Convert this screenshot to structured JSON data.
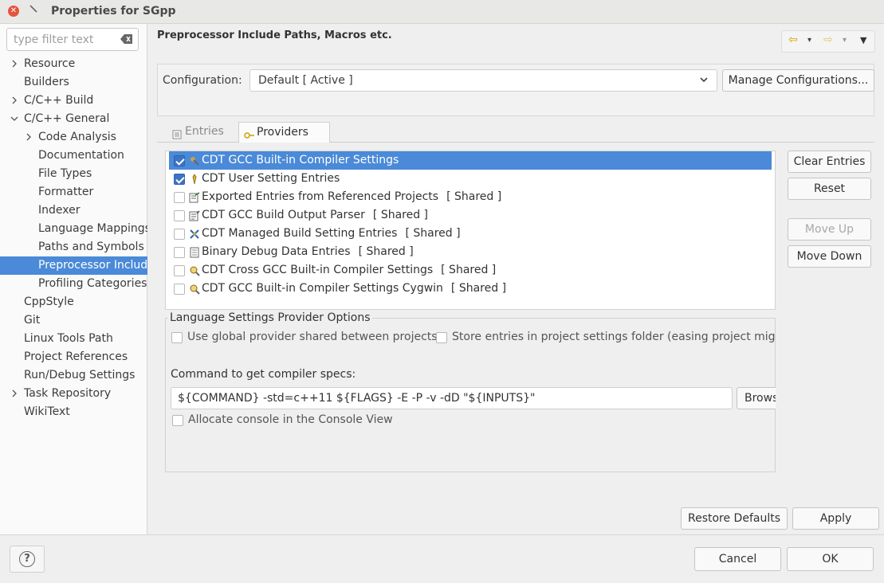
{
  "window": {
    "title": "Properties for SGpp"
  },
  "sidebar": {
    "filter_placeholder": "type filter text",
    "items": [
      {
        "label": "Resource",
        "indent": 0,
        "twisty": "closed"
      },
      {
        "label": "Builders",
        "indent": 0,
        "twisty": "none"
      },
      {
        "label": "C/C++ Build",
        "indent": 0,
        "twisty": "closed"
      },
      {
        "label": "C/C++ General",
        "indent": 0,
        "twisty": "open"
      },
      {
        "label": "Code Analysis",
        "indent": 1,
        "twisty": "closed"
      },
      {
        "label": "Documentation",
        "indent": 1,
        "twisty": "none"
      },
      {
        "label": "File Types",
        "indent": 1,
        "twisty": "none"
      },
      {
        "label": "Formatter",
        "indent": 1,
        "twisty": "none"
      },
      {
        "label": "Indexer",
        "indent": 1,
        "twisty": "none"
      },
      {
        "label": "Language Mappings",
        "indent": 1,
        "twisty": "none"
      },
      {
        "label": "Paths and Symbols",
        "indent": 1,
        "twisty": "none"
      },
      {
        "label": "Preprocessor Include Paths, Macros etc.",
        "indent": 1,
        "twisty": "none",
        "selected": true
      },
      {
        "label": "Profiling Categories",
        "indent": 1,
        "twisty": "none"
      },
      {
        "label": "CppStyle",
        "indent": 0,
        "twisty": "none"
      },
      {
        "label": "Git",
        "indent": 0,
        "twisty": "none"
      },
      {
        "label": "Linux Tools Path",
        "indent": 0,
        "twisty": "none"
      },
      {
        "label": "Project References",
        "indent": 0,
        "twisty": "none"
      },
      {
        "label": "Run/Debug Settings",
        "indent": 0,
        "twisty": "none"
      },
      {
        "label": "Task Repository",
        "indent": 0,
        "twisty": "closed"
      },
      {
        "label": "WikiText",
        "indent": 0,
        "twisty": "none"
      }
    ]
  },
  "page": {
    "title": "Preprocessor Include Paths, Macros etc.",
    "configuration_label": "Configuration:",
    "configuration_value": "Default  [ Active ]",
    "manage_button": "Manage Configurations...",
    "tabs": [
      {
        "label": "Entries",
        "active": false
      },
      {
        "label": "Providers",
        "active": true
      }
    ],
    "providers": [
      {
        "label": "CDT GCC Built-in Compiler Settings",
        "shared": "",
        "checked": true,
        "selected": true,
        "icon": "compiler-icon"
      },
      {
        "label": "CDT User Setting Entries",
        "shared": "",
        "checked": true,
        "selected": false,
        "icon": "user-entries-icon"
      },
      {
        "label": "Exported Entries from Referenced Projects",
        "shared": "[ Shared ]",
        "checked": false,
        "selected": false,
        "icon": "exported-entries-icon"
      },
      {
        "label": "CDT GCC Build Output Parser",
        "shared": "[ Shared ]",
        "checked": false,
        "selected": false,
        "icon": "parser-icon"
      },
      {
        "label": "CDT Managed Build Setting Entries",
        "shared": "[ Shared ]",
        "checked": false,
        "selected": false,
        "icon": "managed-build-icon"
      },
      {
        "label": "Binary Debug Data Entries",
        "shared": "[ Shared ]",
        "checked": false,
        "selected": false,
        "icon": "debug-data-icon"
      },
      {
        "label": "CDT Cross GCC Built-in Compiler Settings",
        "shared": "[ Shared ]",
        "checked": false,
        "selected": false,
        "icon": "cross-compiler-icon"
      },
      {
        "label": "CDT GCC Built-in Compiler Settings Cygwin",
        "shared": "[ Shared ]",
        "checked": false,
        "selected": false,
        "icon": "cygwin-compiler-icon"
      }
    ],
    "side_buttons": {
      "clear": "Clear Entries",
      "reset": "Reset",
      "move_up": "Move Up",
      "move_down": "Move Down"
    },
    "options": {
      "legend": "Language Settings Provider Options",
      "use_global": "Use global provider shared between projects",
      "store_entries": "Store entries in project settings folder (easing project migration)",
      "command_label": "Command to get compiler specs:",
      "command_value": "${COMMAND} -std=c++11 ${FLAGS} -E -P -v -dD \"${INPUTS}\"",
      "browse": "Browse...",
      "allocate_console": "Allocate console in the Console View"
    },
    "restore_defaults": "Restore Defaults",
    "apply": "Apply"
  },
  "footer": {
    "cancel": "Cancel",
    "ok": "OK"
  }
}
